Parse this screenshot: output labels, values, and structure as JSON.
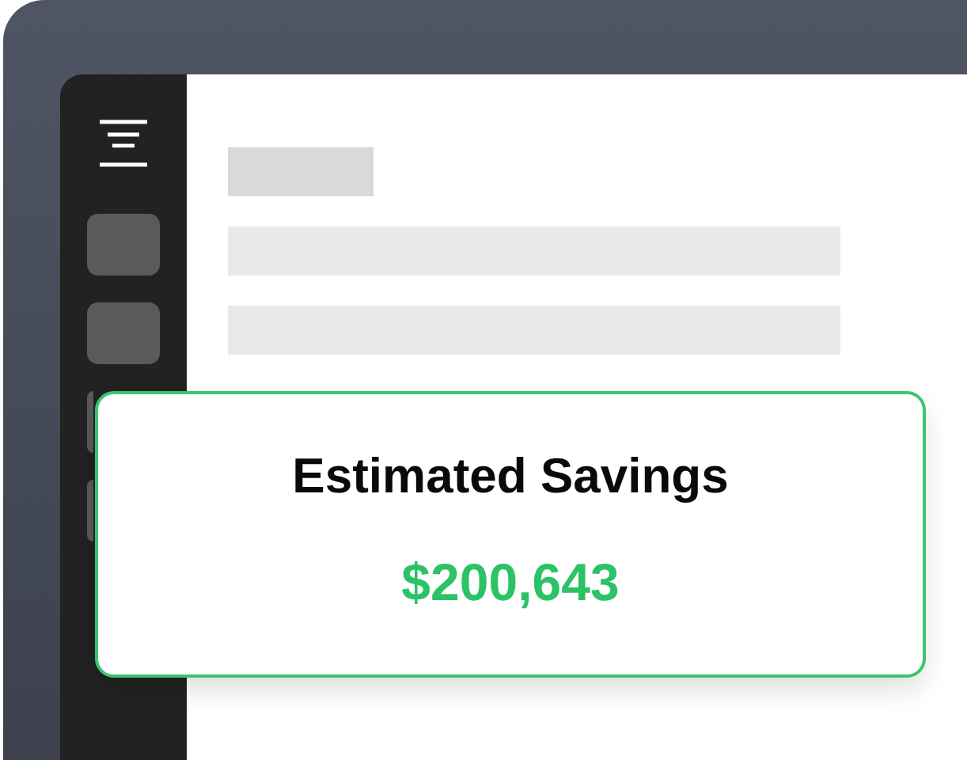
{
  "savings_card": {
    "title": "Estimated Savings",
    "value": "$200,643"
  }
}
